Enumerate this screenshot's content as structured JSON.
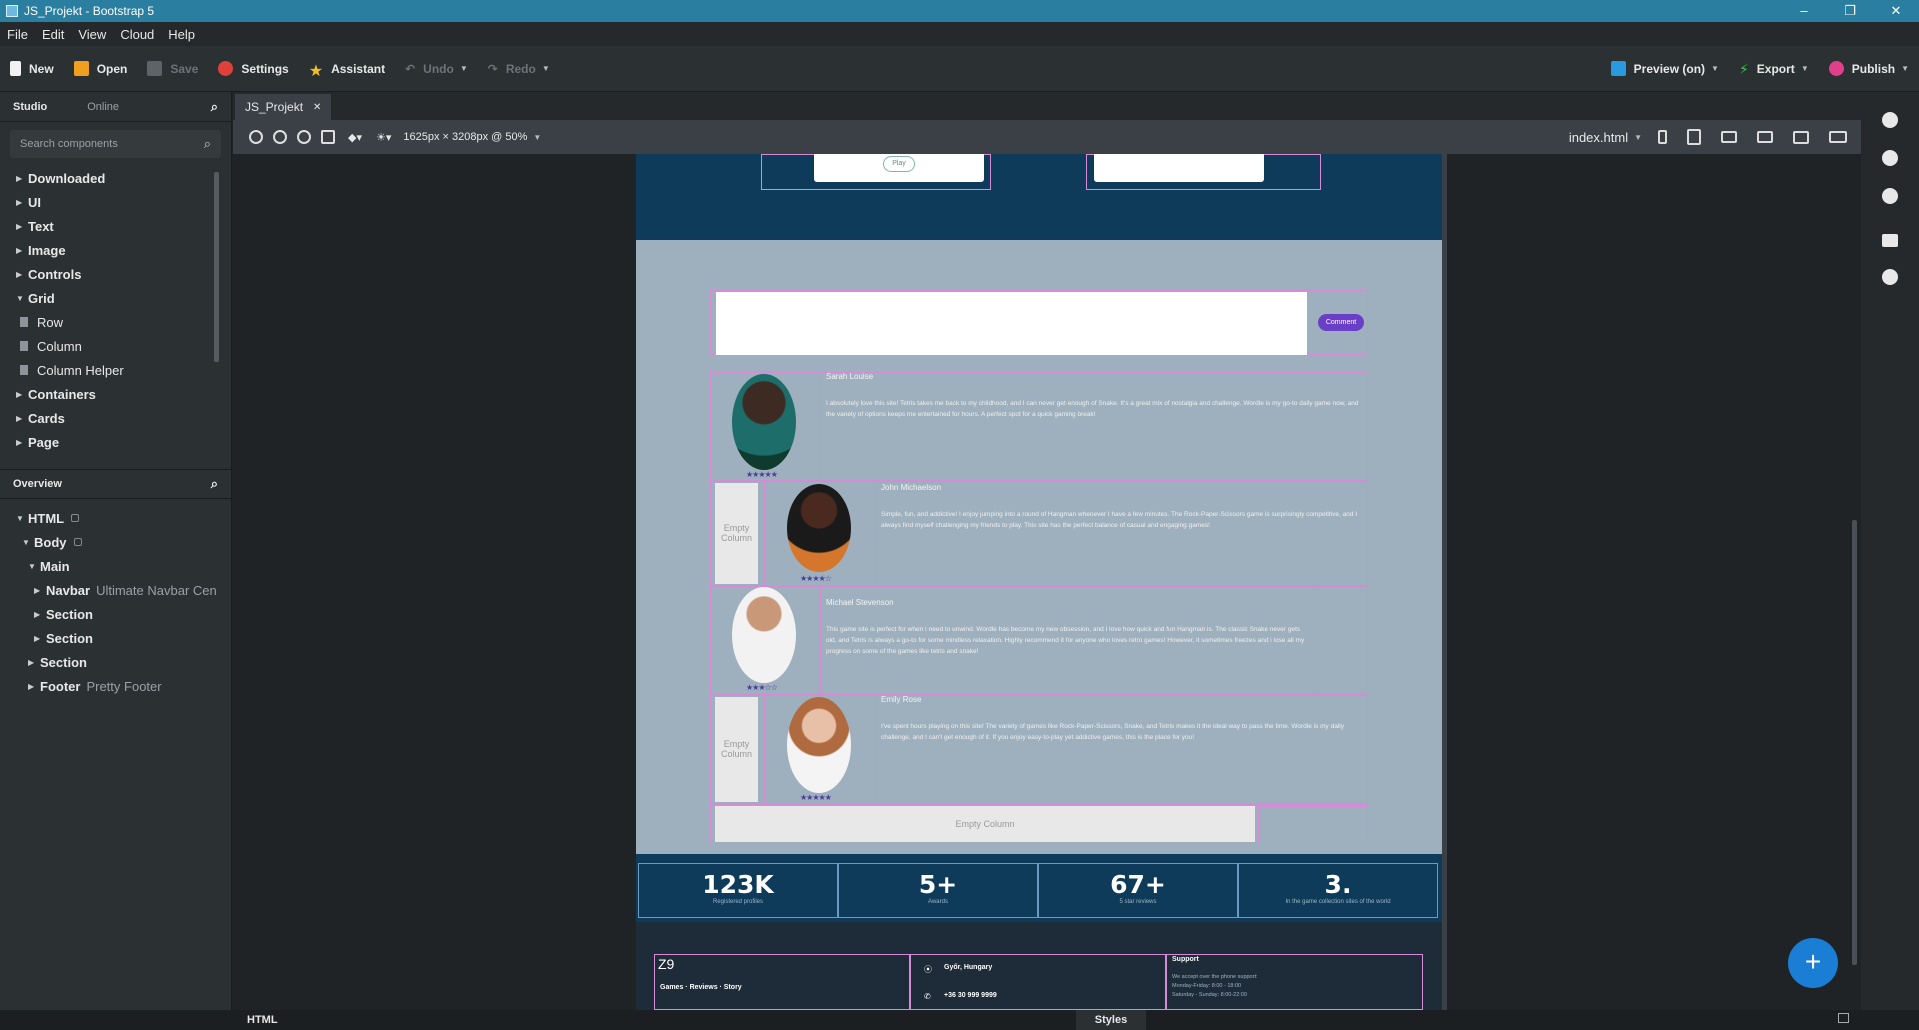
{
  "window": {
    "title": "JS_Projekt - Bootstrap 5"
  },
  "menu": [
    "File",
    "Edit",
    "View",
    "Cloud",
    "Help"
  ],
  "toolbar": {
    "new": "New",
    "open": "Open",
    "save": "Save",
    "settings": "Settings",
    "assistant": "Assistant",
    "undo": "Undo",
    "redo": "Redo",
    "preview": "Preview (on)",
    "export": "Export",
    "publish": "Publish"
  },
  "left_panel": {
    "tabs": [
      "Studio",
      "Online"
    ],
    "search_placeholder": "Search components",
    "categories": [
      {
        "label": "Downloaded"
      },
      {
        "label": "UI"
      },
      {
        "label": "Text"
      },
      {
        "label": "Image"
      },
      {
        "label": "Controls"
      },
      {
        "label": "Grid"
      },
      {
        "label": "Row"
      },
      {
        "label": "Column"
      },
      {
        "label": "Column Helper"
      },
      {
        "label": "Containers"
      },
      {
        "label": "Cards"
      },
      {
        "label": "Page"
      }
    ],
    "overview_title": "Overview",
    "overview": [
      {
        "label": "HTML"
      },
      {
        "label": "Body"
      },
      {
        "label": "Main"
      },
      {
        "label": "Navbar",
        "note": "Ultimate Navbar Cen"
      },
      {
        "label": "Section"
      },
      {
        "label": "Section"
      },
      {
        "label": "Section"
      },
      {
        "label": "Footer",
        "note": "Pretty Footer"
      }
    ]
  },
  "canvas": {
    "tab": "JS_Projekt",
    "size_readout": "1625px × 3208px @ 50%",
    "file": "index.html"
  },
  "page": {
    "play_label": "Play",
    "comment_label": "Comment",
    "empty_column": "Empty Column",
    "empty_line1": "Empty",
    "empty_line2": "Column",
    "reviews": [
      {
        "name": "Sarah Louise",
        "stars": "★★★★★",
        "text": "I absolutely love this site! Tetris takes me back to my childhood, and I can never get enough of Snake. It's a great mix of nostalgia and challenge. Wordle is my go-to daily game now, and the variety of options keeps me entertained for hours. A perfect spot for a quick gaming break!"
      },
      {
        "name": "John Michaelson",
        "stars": "★★★★☆",
        "text": "Simple, fun, and addictive! I enjoy jumping into a round of Hangman whenever I have a few minutes. The Rock-Paper-Scissors game is surprisingly competitive, and I always find myself challenging my friends to play. This site has the perfect balance of casual and engaging games!"
      },
      {
        "name": "Michael Stevenson",
        "stars": "★★★☆☆",
        "text": "This game site is perfect for when I need to unwind. Wordle has become my new obsession, and I love how quick and fun Hangman is. The classic Snake never gets old, and Tetris is always a go-to for some mindless relaxation. Highly recommend it for anyone who loves retro games! However, it sometimes freezes and i lose all my progress on some of the games like tetris and snake!"
      },
      {
        "name": "Emily Rose",
        "stars": "★★★★★",
        "text": "I've spent hours playing on this site! The variety of games like Rock-Paper-Scissors, Snake, and Tetris makes it the ideal way to pass the time. Wordle is my daily challenge, and I can't get enough of it. If you enjoy easy-to-play yet addictive games, this is the place for you!"
      }
    ],
    "stats": [
      {
        "value": "123K",
        "label": "Registered profiles"
      },
      {
        "value": "5+",
        "label": "Awards"
      },
      {
        "value": "67+",
        "label": "5 star reviews"
      },
      {
        "value": "3.",
        "label": "In the game collection sites of the world"
      }
    ],
    "footer": {
      "brand": "Z9",
      "links": "Games · Reviews · Story",
      "location": "Győr, Hungary",
      "phone": "+36 30 999 9999",
      "support_title": "Support",
      "support_line1": "We accept over the phone support:",
      "support_line2": "Monday-Friday: 8:00 - 18:00",
      "support_line3": "Saturday - Sunday: 8:00-22:00"
    }
  },
  "statusbar": {
    "left": "HTML",
    "center": "Styles"
  },
  "colors": {
    "titlebar": "#2a7ea0",
    "page_navy": "#0e3b5a",
    "page_grey": "#9eb0bd",
    "accent_purple": "#6a3fc8",
    "fab": "#1a7fd4"
  }
}
